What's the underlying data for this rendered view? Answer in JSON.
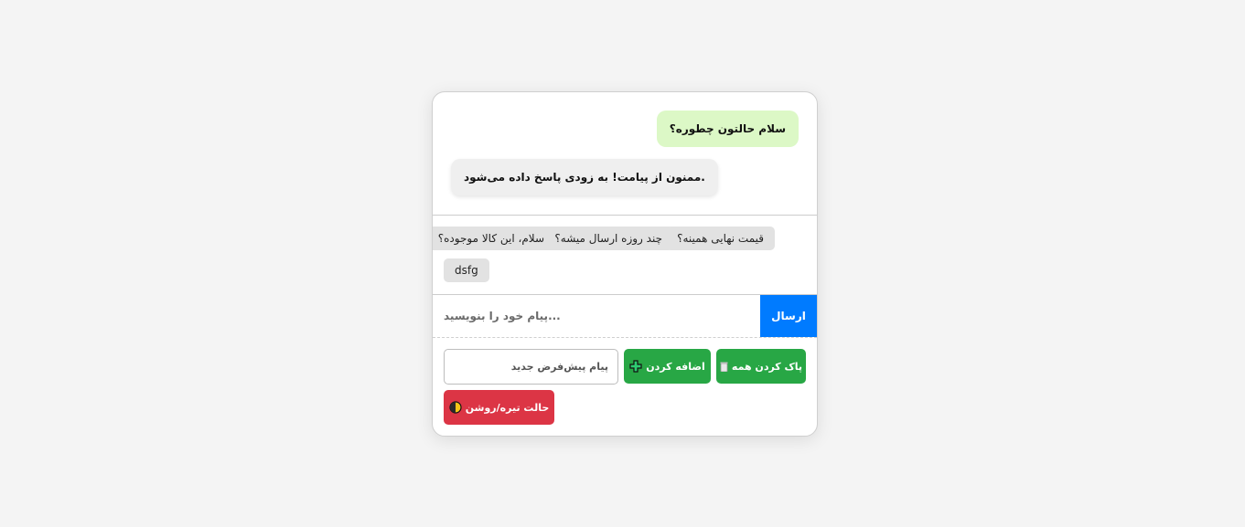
{
  "messages": [
    {
      "role": "user",
      "text": "سلام حالتون چطوره؟"
    },
    {
      "role": "bot",
      "text": ".ممنون از پیامت! به زودی پاسخ داده می‌شود"
    }
  ],
  "quick_replies": [
    "قیمت نهایی همینه؟",
    "چند روزه ارسال میشه؟",
    "سلام، این کالا موجوده؟",
    "dsfg"
  ],
  "composer": {
    "placeholder": "...پیام خود را بنویسید",
    "send_label": "ارسال"
  },
  "controls": {
    "clear_all_label": "پاک کردن همه",
    "add_label": "اضافه کردن",
    "preset_placeholder": "پیام پیش‌فرض جدید",
    "theme_toggle_label": "حالت تیره/روشن",
    "icons": {
      "clear_all": "trash-icon",
      "add": "plus-icon",
      "theme": "half-moon-icon"
    }
  },
  "colors": {
    "send": "#007bff",
    "green": "#28a745",
    "red": "#dc3545",
    "user_bubble": "#dcf8c6",
    "bot_bubble": "#efefef",
    "chip": "#e2e2e2"
  }
}
